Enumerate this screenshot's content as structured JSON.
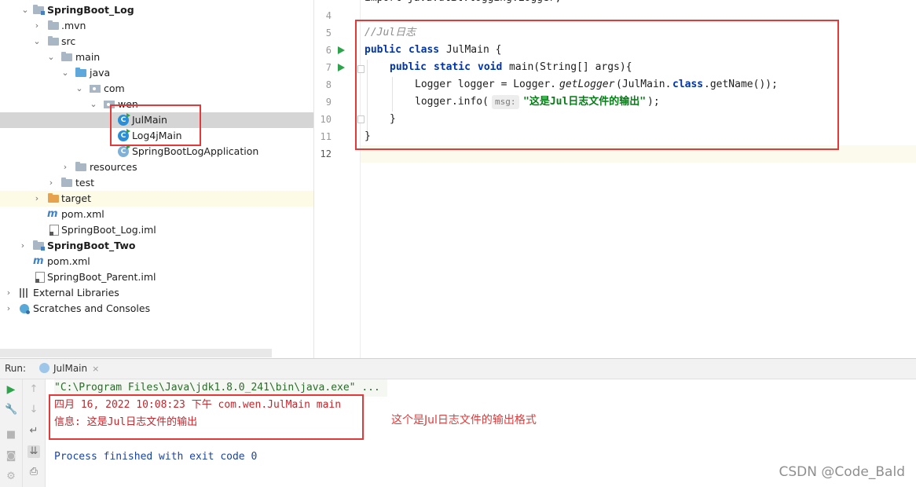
{
  "project_tree": {
    "items": [
      {
        "label": "SpringBoot_Log",
        "icon": "module-folder-icon",
        "bold": true
      },
      {
        "label": ".mvn",
        "icon": "folder-icon"
      },
      {
        "label": "src",
        "icon": "folder-icon"
      },
      {
        "label": "main",
        "icon": "folder-icon"
      },
      {
        "label": "java",
        "icon": "source-folder-icon"
      },
      {
        "label": "com",
        "icon": "package-icon"
      },
      {
        "label": "wen",
        "icon": "package-icon"
      },
      {
        "label": "JulMain",
        "icon": "class-icon",
        "selected": true
      },
      {
        "label": "Log4jMain",
        "icon": "class-icon"
      },
      {
        "label": "SpringBootLogApplication",
        "icon": "spring-class-icon"
      },
      {
        "label": "resources",
        "icon": "resources-folder-icon"
      },
      {
        "label": "test",
        "icon": "folder-icon"
      },
      {
        "label": "target",
        "icon": "excluded-folder-icon"
      },
      {
        "label": "pom.xml",
        "icon": "maven-icon"
      },
      {
        "label": "SpringBoot_Log.iml",
        "icon": "iml-file-icon"
      },
      {
        "label": "SpringBoot_Two",
        "icon": "module-folder-icon",
        "bold": true
      },
      {
        "label": "pom.xml",
        "icon": "maven-icon"
      },
      {
        "label": "SpringBoot_Parent.iml",
        "icon": "iml-file-icon"
      },
      {
        "label": "External Libraries",
        "icon": "libraries-icon"
      },
      {
        "label": "Scratches and Consoles",
        "icon": "scratches-icon"
      }
    ]
  },
  "editor": {
    "line_numbers": [
      "4",
      "5",
      "6",
      "7",
      "8",
      "9",
      "10",
      "11",
      "12"
    ],
    "top_partial_line": "import java.util.logging.Logger;",
    "lines": {
      "l5_comment": "//Jul日志",
      "l6_kw1": "public",
      "l6_kw2": "class",
      "l6_rest": "JulMain {",
      "l7_kw1": "public",
      "l7_kw2": "static",
      "l7_kw3": "void",
      "l7_rest": "main(String[] args){",
      "l8_a": "Logger logger = Logger.",
      "l8_b": "getLogger",
      "l8_c": "(JulMain.",
      "l8_kw": "class",
      "l8_d": ".getName());",
      "l9_a": "logger.info(",
      "l9_hint": "msg:",
      "l9_str": "\"这是Jul日志文件的输出\"",
      "l9_end": ");",
      "l10": "}",
      "l11": "}"
    }
  },
  "run_panel": {
    "label": "Run:",
    "tab": "JulMain",
    "close_glyph": "×",
    "console": {
      "cmd": "\"C:\\Program Files\\Java\\jdk1.8.0_241\\bin\\java.exe\" ...",
      "log1": "四月 16, 2022 10:08:23 下午 com.wen.JulMain main",
      "log2": "信息: 这是Jul日志文件的输出",
      "exit": "Process finished with exit code 0"
    }
  },
  "annotation": "这个是Jul日志文件的输出格式",
  "watermark": "CSDN @Code_Bald",
  "colors": {
    "annotation_red": "#e23a3a",
    "run_green": "#2fa34b",
    "keyword_blue": "#0033b3",
    "string_green": "#067d17"
  }
}
